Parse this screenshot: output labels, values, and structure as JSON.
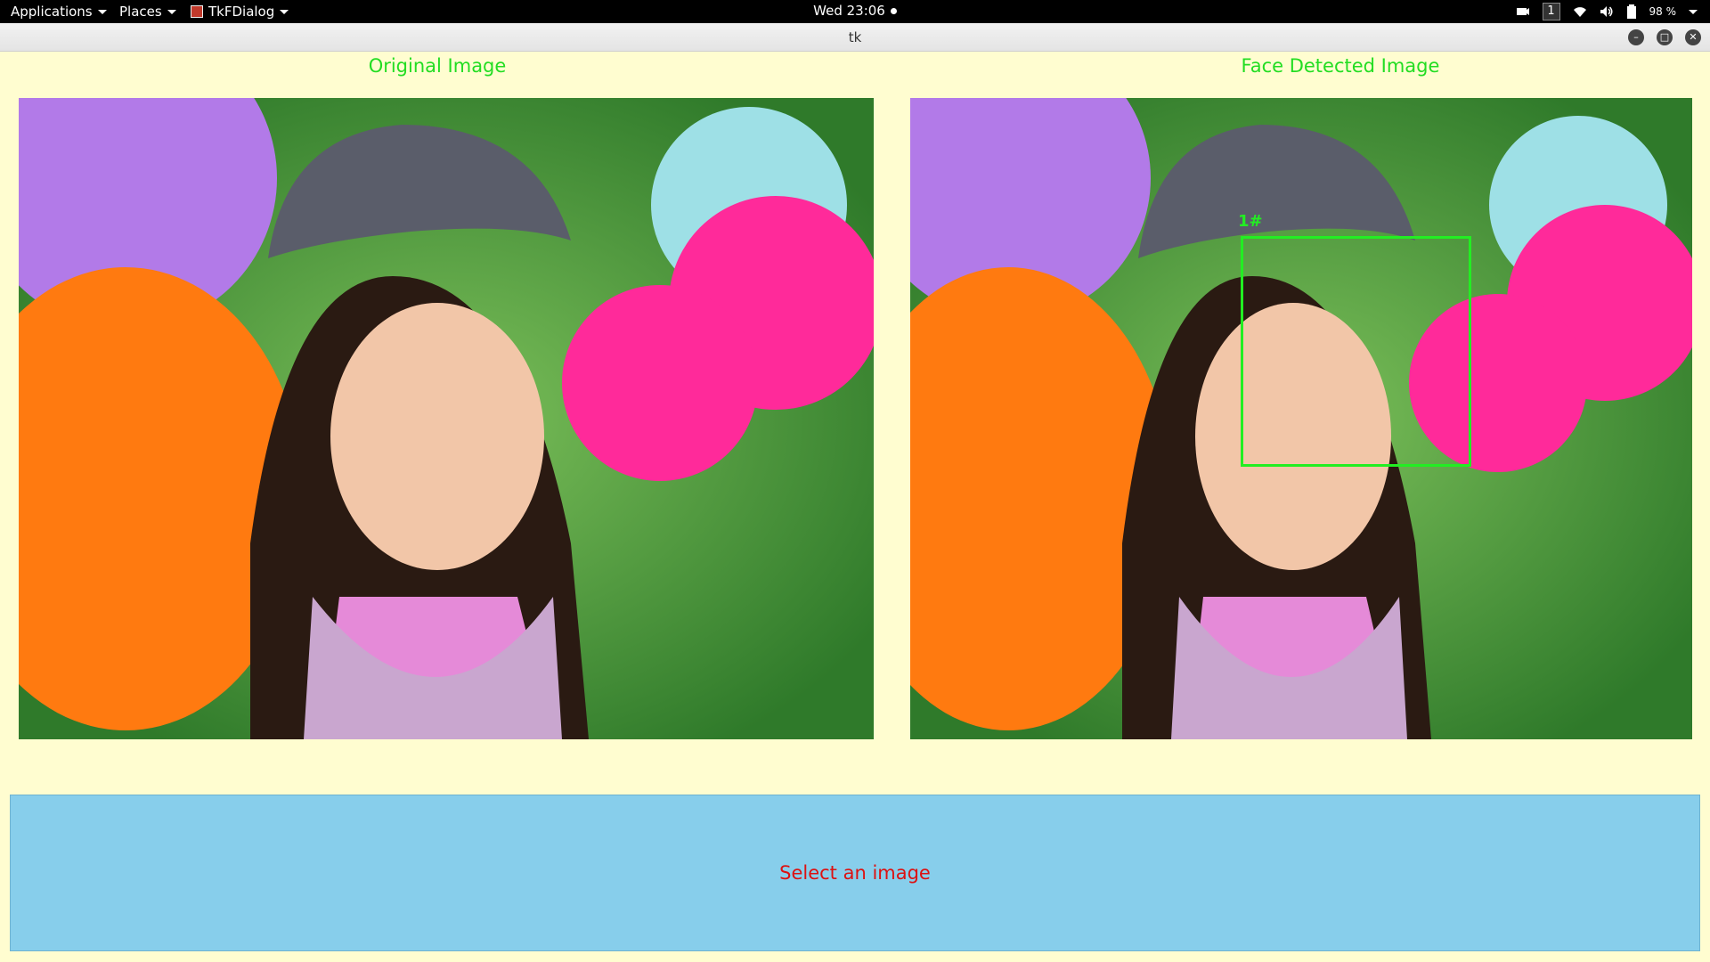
{
  "top_bar": {
    "applications_label": "Applications",
    "places_label": "Places",
    "active_app_label": "TkFDialog",
    "clock": "Wed 23:06",
    "workspace_number": "1",
    "battery_percent": "98 %"
  },
  "window": {
    "title": "tk"
  },
  "panels": {
    "original_label": "Original Image",
    "detected_label": "Face Detected Image",
    "face_tag": "1#"
  },
  "status": {
    "message": "Select an image"
  },
  "colors": {
    "background": "#fffdd0",
    "label_green": "#22dd22",
    "status_panel": "#87ceeb",
    "status_text": "#dd1111",
    "face_box": "#22ee22"
  }
}
